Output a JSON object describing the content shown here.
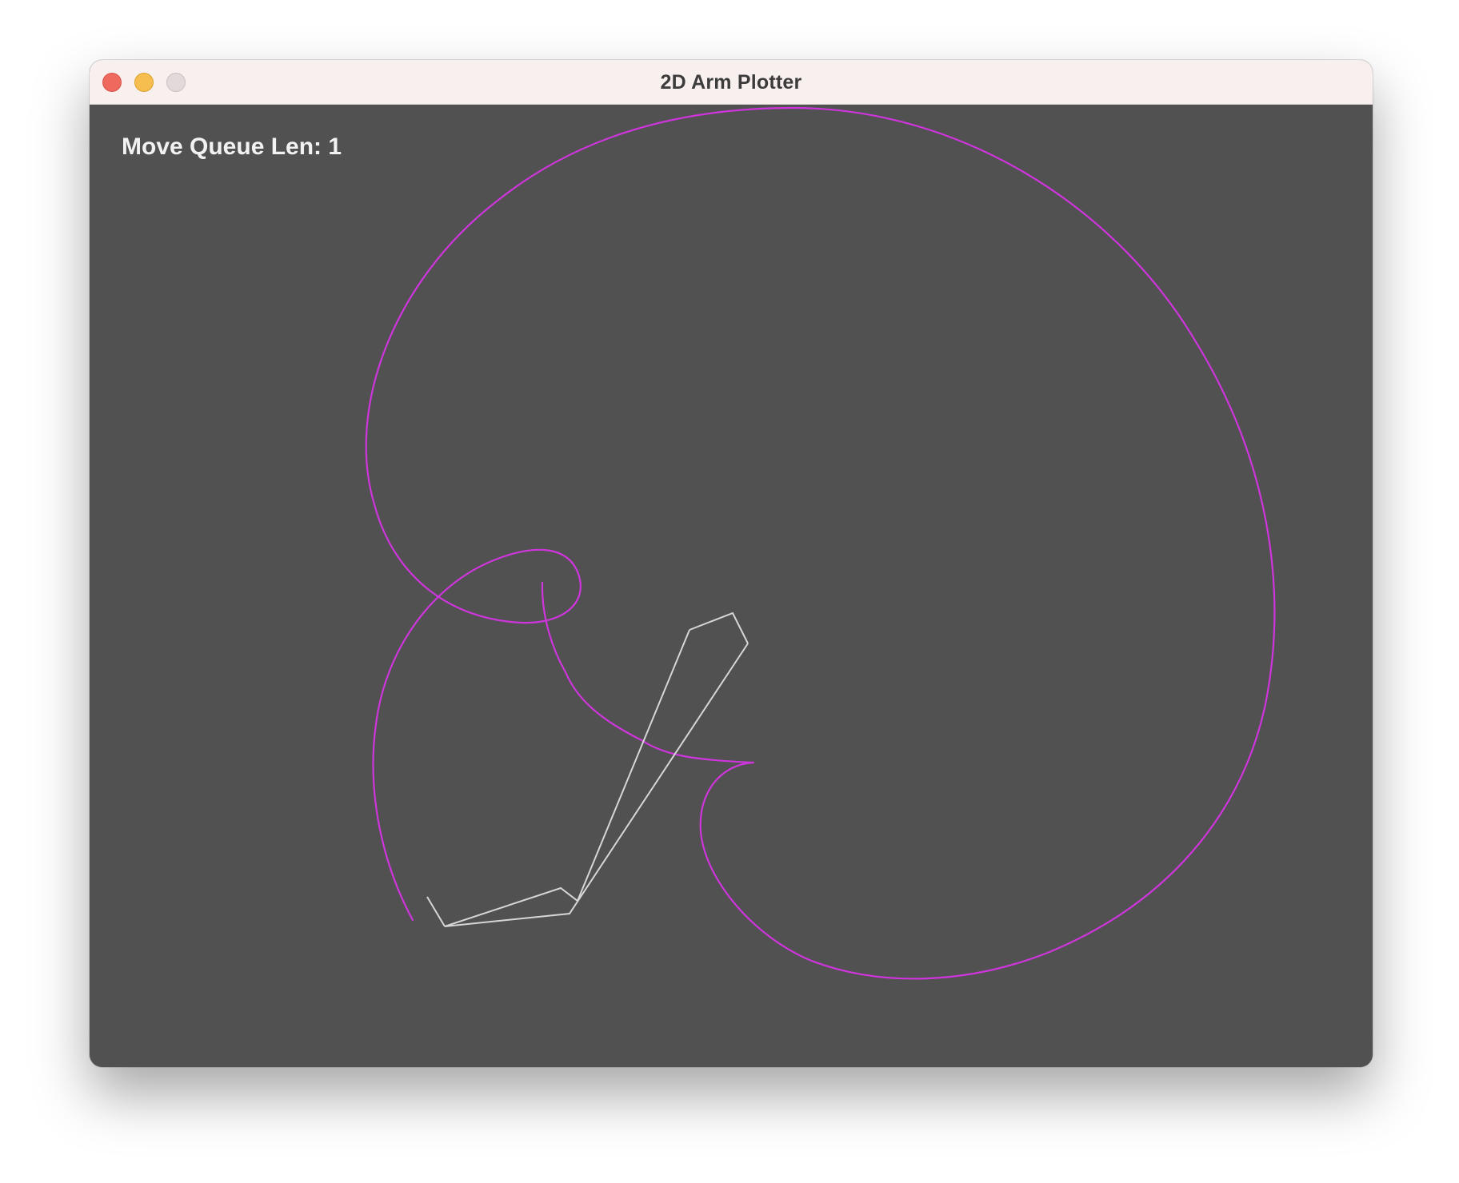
{
  "window": {
    "title": "2D Arm Plotter"
  },
  "overlay": {
    "queue_label": "Move Queue Len: ",
    "queue_length": "1"
  },
  "colors": {
    "traffic_close": "#ee6a5f",
    "traffic_minimize": "#f5be4f",
    "traffic_zoom": "#e2dada",
    "canvas_background": "#515151",
    "trace": "#cf35dc",
    "arm": "#d6d6d6"
  },
  "icons": {
    "close": "close-icon",
    "minimize": "minimize-icon",
    "zoom": "zoom-icon"
  }
}
